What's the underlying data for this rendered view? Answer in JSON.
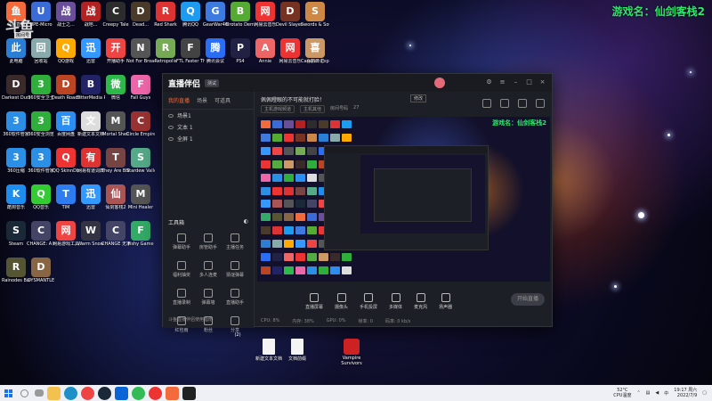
{
  "game_label": "游戏名：仙剑客栈2",
  "overlay": {
    "logo": "斗鱼",
    "room_badge": "房间号"
  },
  "desktop_icons": [
    {
      "label": "斗鱼直播",
      "color": "#f36b3c",
      "glyph": "鱼"
    },
    {
      "label": "UPE-Micro",
      "color": "#3b6bd6",
      "glyph": "U"
    },
    {
      "label": "战士之...",
      "color": "#6a4e9a",
      "glyph": "战"
    },
    {
      "label": "战地...",
      "color": "#b22222",
      "glyph": "战"
    },
    {
      "label": "Creepy Tale",
      "color": "#2c2c2c",
      "glyph": "C"
    },
    {
      "label": "Dead...",
      "color": "#4a3a2a",
      "glyph": "D"
    },
    {
      "label": "Red Shark",
      "color": "#d33",
      "glyph": "R"
    },
    {
      "label": "腾讯QQ",
      "color": "#1d9bf0",
      "glyph": "Q"
    },
    {
      "label": "GearWar46",
      "color": "#3d7be0",
      "glyph": "G"
    },
    {
      "label": "Brotato Demo",
      "color": "#5a3",
      "glyph": "B"
    },
    {
      "label": "网易云音乐",
      "color": "#e33",
      "glyph": "网"
    },
    {
      "label": "Devil Slayer - Raksasi",
      "color": "#732",
      "glyph": "D"
    },
    {
      "label": "Swords & Souls",
      "color": "#c84",
      "glyph": "S"
    },
    {
      "label": "此电脑",
      "color": "#2a7fd4",
      "glyph": "此"
    },
    {
      "label": "回收站",
      "color": "#8aa",
      "glyph": "回"
    },
    {
      "label": "QQ游戏",
      "color": "#fa0",
      "glyph": "Q"
    },
    {
      "label": "迅雷",
      "color": "#3399ff",
      "glyph": "迅"
    },
    {
      "label": "开播助手",
      "color": "#e44",
      "glyph": "开"
    },
    {
      "label": "Not For Broadcast",
      "color": "#555",
      "glyph": "N"
    },
    {
      "label": "Retropolis",
      "color": "#7a5",
      "glyph": "R"
    },
    {
      "label": "FTL Faster Than Light",
      "color": "#444",
      "glyph": "F"
    },
    {
      "label": "腾讯会议",
      "color": "#2a6ef5",
      "glyph": "腾"
    },
    {
      "label": "PS4",
      "color": "#224",
      "glyph": "P"
    },
    {
      "label": "Annie",
      "color": "#e66",
      "glyph": "A"
    },
    {
      "label": "网易云音乐",
      "color": "#e33",
      "glyph": "网"
    },
    {
      "label": "Caravan Expedition",
      "color": "#5a4",
      "glyph": "C"
    },
    {
      "label": "喜鹊日记",
      "color": "#c96",
      "glyph": "喜"
    },
    {
      "label": "Darkest Dungeon",
      "color": "#3a2a2a",
      "glyph": "D"
    },
    {
      "label": "360安全卫士",
      "color": "#2fae3b",
      "glyph": "3"
    },
    {
      "label": "Death Road to Canada",
      "color": "#b42",
      "glyph": "D"
    },
    {
      "label": "BitterMedia RECentral",
      "color": "#226",
      "glyph": "B"
    },
    {
      "label": "微信",
      "color": "#2db84a",
      "glyph": "微"
    },
    {
      "label": "Fall Guys",
      "color": "#e6a",
      "glyph": "F"
    },
    {
      "label": "360软件管家",
      "color": "#2b8fe6",
      "glyph": "3"
    },
    {
      "label": "360安全浏览",
      "color": "#2fae3b",
      "glyph": "3"
    },
    {
      "label": "百度网盘",
      "color": "#2a8ff0",
      "glyph": "百"
    },
    {
      "label": "新建文本文档",
      "color": "#ddd",
      "glyph": "文"
    },
    {
      "label": "Mortal Shell",
      "color": "#555",
      "glyph": "M"
    },
    {
      "label": "Circle Empire",
      "color": "#933",
      "glyph": "C"
    },
    {
      "label": "360压缩",
      "color": "#2b8fe6",
      "glyph": "3"
    },
    {
      "label": "360软件管家",
      "color": "#2b8fe6",
      "glyph": "3"
    },
    {
      "label": "QQ SkinnDb",
      "color": "#e33",
      "glyph": "Q"
    },
    {
      "label": "网易有道词典",
      "color": "#d33",
      "glyph": "有"
    },
    {
      "label": "They Are Billions",
      "color": "#744",
      "glyph": "T"
    },
    {
      "label": "Stardew Valley",
      "color": "#5a8",
      "glyph": "S"
    },
    {
      "label": "酷狗音乐",
      "color": "#1d8ef0",
      "glyph": "K"
    },
    {
      "label": "QQ音乐",
      "color": "#3c3",
      "glyph": "Q"
    },
    {
      "label": "TIM",
      "color": "#2d7cf0",
      "glyph": "T"
    },
    {
      "label": "迅雷",
      "color": "#3399ff",
      "glyph": "迅"
    },
    {
      "label": "仙剑客栈2",
      "color": "#a55",
      "glyph": "仙"
    },
    {
      "label": "Mini Healer",
      "color": "#555",
      "glyph": "M"
    },
    {
      "label": "Steam",
      "color": "#1b2838",
      "glyph": "S"
    },
    {
      "label": "CHANGE: A Homeless",
      "color": "#446",
      "glyph": "C"
    },
    {
      "label": "网易游戏工具",
      "color": "#e44",
      "glyph": "网"
    },
    {
      "label": "Warm Snow",
      "color": "#334",
      "glyph": "W"
    },
    {
      "label": "CHANGE 无家可归",
      "color": "#446",
      "glyph": "C"
    },
    {
      "label": "Fishy Game",
      "color": "#3a6",
      "glyph": "F"
    },
    {
      "label": "Rainodes Barrogames",
      "color": "#553",
      "glyph": "R"
    },
    {
      "label": "DYSMANTLE",
      "color": "#864",
      "glyph": "D"
    }
  ],
  "app": {
    "brand": "直播伴侣",
    "badge": "测试",
    "tabs": [
      "我的直播",
      "场景",
      "可道具"
    ],
    "sources": [
      "场景1",
      "文本 1",
      "全屏 1"
    ],
    "tools_title": "工具箱",
    "tools": [
      "弹幕助手",
      "房管助手",
      "主播任务",
      "福利抽奖",
      "多人连麦",
      "猜谜弹幕",
      "直播录制",
      "弹幕墙",
      "直播助手",
      "红包雨",
      "粉丝",
      "分享"
    ],
    "left_footer": "斗鱼直播伴侣使用指南",
    "room_title": "佩佩瞪眼的不可能就打脸！",
    "room_edit": "修改",
    "room_category": "主机游戏频道",
    "room_subcategory": "主机其他",
    "room_number": "房间号码",
    "room_count": "27",
    "preview_label": "游戏名：仙剑客栈2",
    "bottom_tools": [
      "直播屏幕",
      "摄像头",
      "手机投屏",
      "多媒体",
      "麦克风",
      "扬声器"
    ],
    "start_live": "开始直播",
    "stats": [
      "CPU: 8%",
      "内存: 38%",
      "GPU: 0%",
      "帧率: 0",
      "码率: 0 kb/s"
    ]
  },
  "lower_icons": [
    "(2)",
    "新建文本文档",
    "文档前缀",
    "Vampire Survivors"
  ],
  "taskbar": {
    "weather_temp": "52°C",
    "weather_desc": "CPU温度",
    "time": "19:17 周六",
    "date": "2022/7/9",
    "lang": "中"
  }
}
